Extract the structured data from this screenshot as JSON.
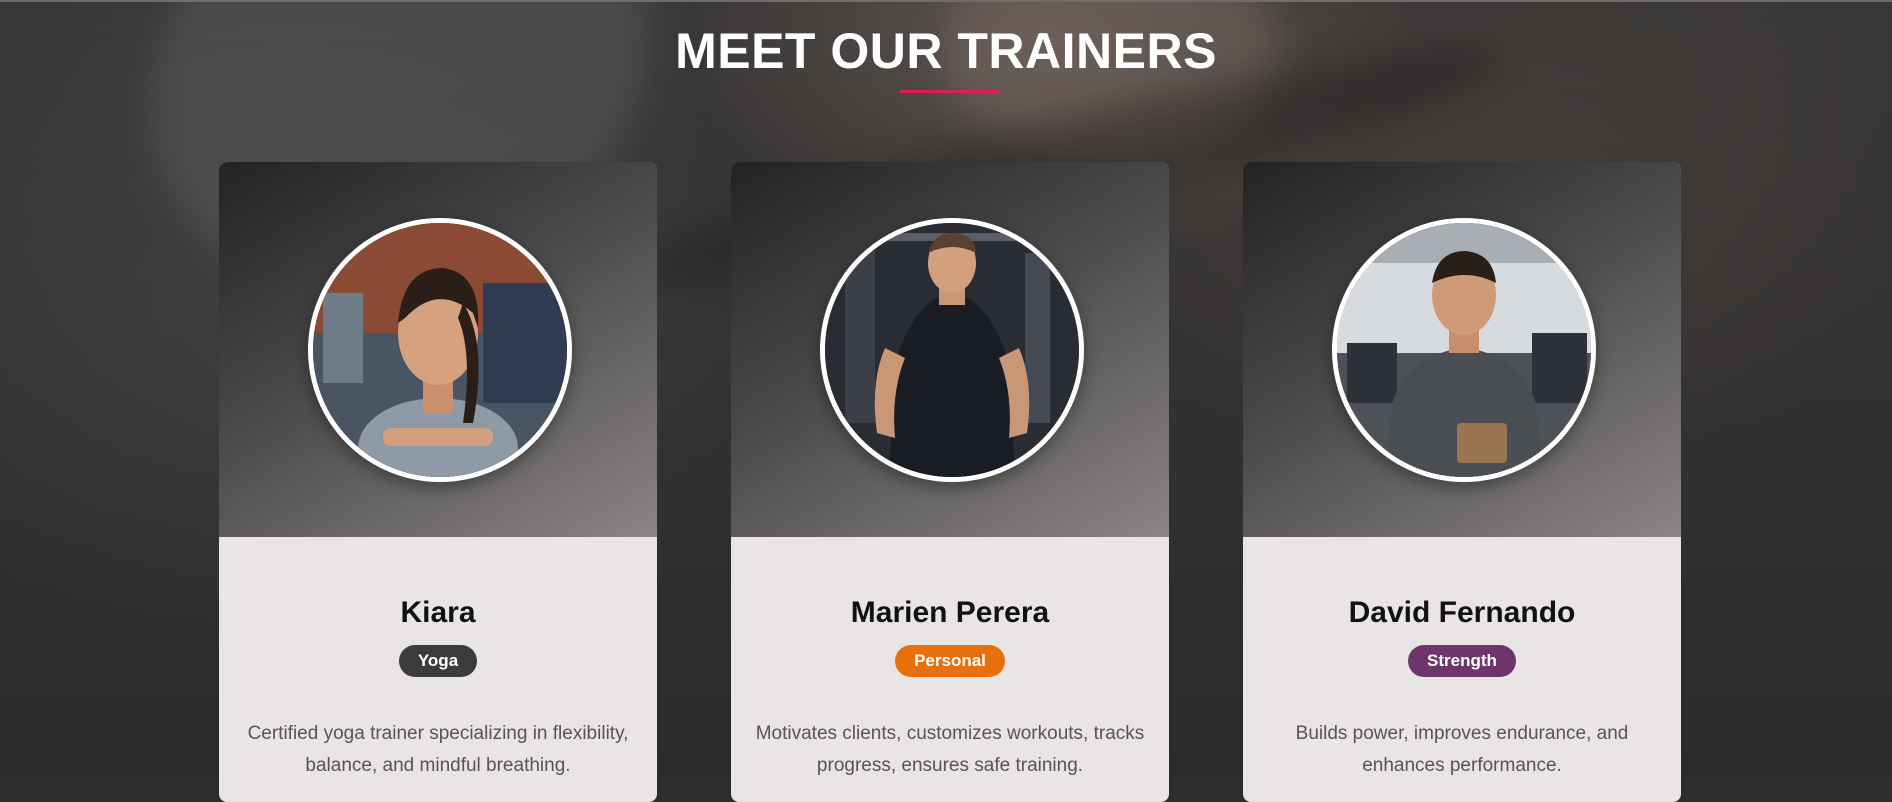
{
  "section": {
    "title": "MEET OUR TRAINERS",
    "underline_color": "#e01b5f"
  },
  "trainers": [
    {
      "name": "Kiara",
      "specialty": "Yoga",
      "badge_color": "#3a3d3a",
      "description": "Certified yoga trainer specializing in flexibility, balance, and mindful breathing.",
      "photo": "trainer-photo-kiara"
    },
    {
      "name": "Marien Perera",
      "specialty": "Personal",
      "badge_color": "#e8700a",
      "description": "Motivates clients, customizes workouts, tracks progress, ensures safe training.",
      "photo": "trainer-photo-marien"
    },
    {
      "name": "David Fernando",
      "specialty": "Strength",
      "badge_color": "#6e356d",
      "description": "Builds power, improves endurance, and enhances performance.",
      "photo": "trainer-photo-david"
    }
  ]
}
